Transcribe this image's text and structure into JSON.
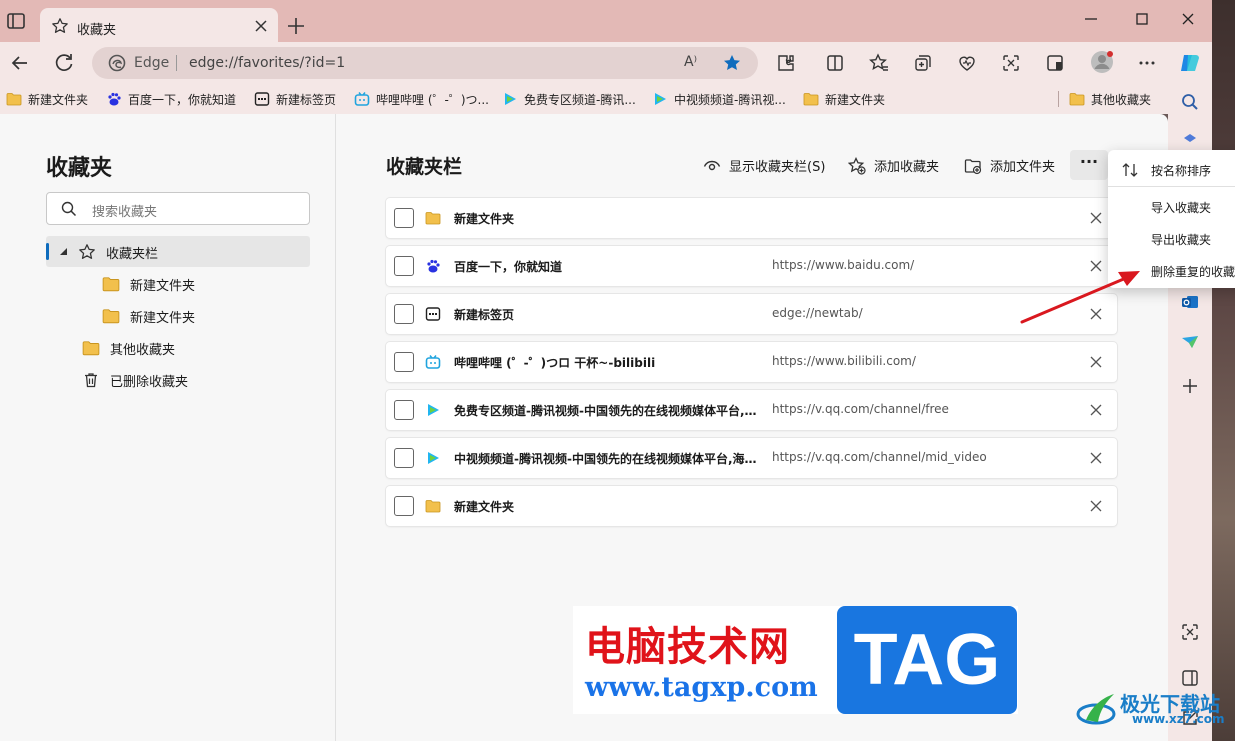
{
  "browser": {
    "tab_title": "收藏夹",
    "address_brand": "Edge",
    "address_url": "edge://favorites/?id=1",
    "read_aloud_label": "A⁾"
  },
  "bookmarks_bar": [
    {
      "label": "新建文件夹",
      "icon": "folder-icon"
    },
    {
      "label": "百度一下，你就知道",
      "icon": "baidu-icon"
    },
    {
      "label": "新建标签页",
      "icon": "newtab-icon"
    },
    {
      "label": "哔哩哔哩 (゜-゜)つ...",
      "icon": "bilibili-icon"
    },
    {
      "label": "免费专区频道-腾讯...",
      "icon": "tencent-video-icon"
    },
    {
      "label": "中视频频道-腾讯视...",
      "icon": "tencent-video-icon"
    },
    {
      "label": "新建文件夹",
      "icon": "folder-icon"
    },
    {
      "label": "其他收藏夹",
      "icon": "folder-icon"
    }
  ],
  "left_pane": {
    "title": "收藏夹",
    "search_placeholder": "搜索收藏夹",
    "tree": [
      {
        "label": "收藏夹栏",
        "icon": "star-icon",
        "selected": true
      },
      {
        "label": "新建文件夹",
        "icon": "folder-icon"
      },
      {
        "label": "新建文件夹",
        "icon": "folder-icon"
      },
      {
        "label": "其他收藏夹",
        "icon": "folder-icon"
      },
      {
        "label": "已删除收藏夹",
        "icon": "trash-icon"
      }
    ]
  },
  "main": {
    "title": "收藏夹栏",
    "actions": {
      "show_bar": "显示收藏夹栏(S)",
      "add_favorite": "添加收藏夹",
      "add_folder": "添加文件夹",
      "more": "···"
    },
    "rows": [
      {
        "name": "新建文件夹",
        "url": "",
        "icon": "folder-icon"
      },
      {
        "name": "百度一下，你就知道",
        "url": "https://www.baidu.com/",
        "icon": "baidu-icon"
      },
      {
        "name": "新建标签页",
        "url": "edge://newtab/",
        "icon": "newtab-icon"
      },
      {
        "name": "哔哩哔哩 (゜-゜)つロ 干杯~-bilibili",
        "url": "https://www.bilibili.com/",
        "icon": "bilibili-icon"
      },
      {
        "name": "免费专区频道-腾讯视频-中国领先的在线视频媒体平台,海...",
        "url": "https://v.qq.com/channel/free",
        "icon": "tencent-video-icon"
      },
      {
        "name": "中视频频道-腾讯视频-中国领先的在线视频媒体平台,海量...",
        "url": "https://v.qq.com/channel/mid_video",
        "icon": "tencent-video-icon"
      },
      {
        "name": "新建文件夹",
        "url": "",
        "icon": "folder-icon"
      }
    ]
  },
  "menu": {
    "sort_by_name": "按名称排序",
    "import": "导入收藏夹",
    "export": "导出收藏夹",
    "remove_duplicates": "删除重复的收藏"
  },
  "watermark": {
    "site_name": "电脑技术网",
    "site_url": "www.tagxp.com",
    "tag": "TAG",
    "corner_name": "极光下载站",
    "corner_url": "www.xz7.com"
  },
  "colors": {
    "accent": "#0f6cbd",
    "titlebar": "#e3b9b6",
    "toolbar": "#f4e7e6",
    "folder": "#f2c04c",
    "arrow": "#d9181f"
  }
}
